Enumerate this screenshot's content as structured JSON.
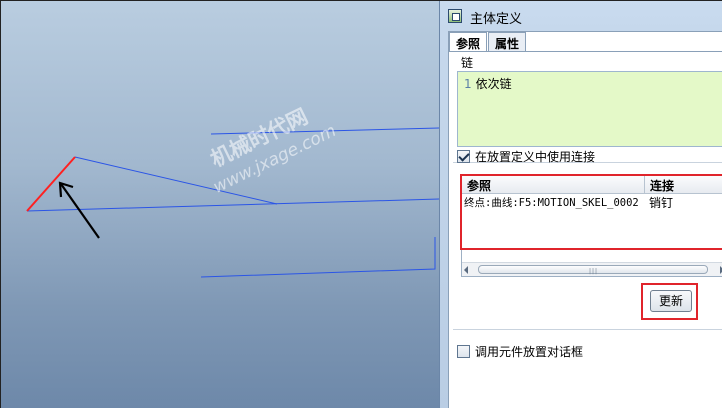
{
  "window": {
    "title": "主体定义"
  },
  "tabs": [
    {
      "label": "参照"
    },
    {
      "label": "属性"
    }
  ],
  "chain": {
    "label": "链",
    "items": [
      {
        "num": "1",
        "text": "依次链"
      }
    ]
  },
  "use_connection": {
    "label": "在放置定义中使用连接",
    "checked": true
  },
  "table": {
    "columns": [
      "参照",
      "连接"
    ],
    "rows": [
      {
        "ref": "终点:曲线:F5:MOTION_SKEL_0002",
        "conn": "销钉"
      }
    ]
  },
  "update_button": {
    "label": "更新"
  },
  "invoke_dialog": {
    "label": "调用元件放置对话框",
    "checked": false
  },
  "watermark": {
    "line1": "机械时代网",
    "line2": "www.jxage.com"
  },
  "colors": {
    "highlight_red": "#e0242b",
    "curve_blue": "#2b55e6",
    "edge_red": "#ff2020",
    "chain_bg": "#e4f9c8"
  }
}
